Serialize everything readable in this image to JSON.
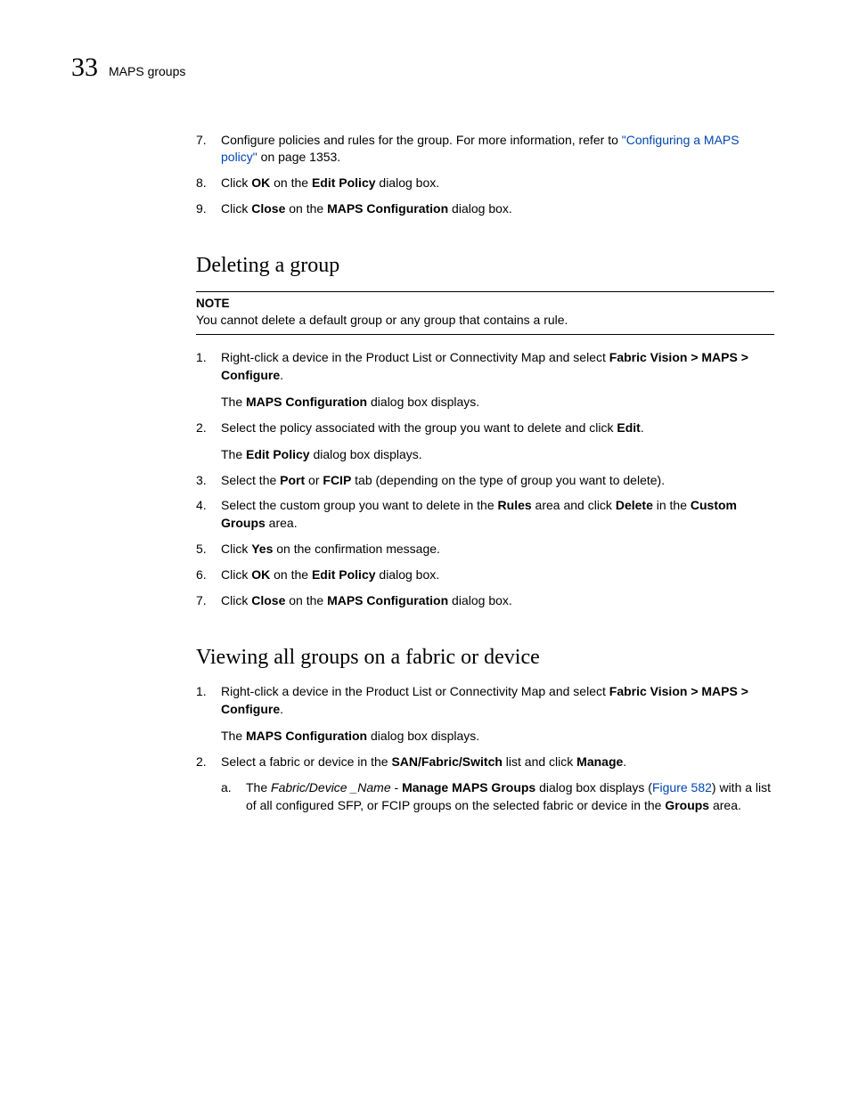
{
  "header": {
    "chapter": "33",
    "title": "MAPS groups"
  },
  "top_list": {
    "item7": {
      "num": "7.",
      "pre": "Configure policies and rules for the group. For more information, refer to ",
      "link": "\"Configuring a MAPS policy\"",
      "post": " on page 1353."
    },
    "item8": {
      "num": "8.",
      "pre": "Click ",
      "b1": "OK",
      "mid1": " on the ",
      "b2": "Edit Policy",
      "post": " dialog box."
    },
    "item9": {
      "num": "9.",
      "pre": "Click ",
      "b1": "Close",
      "mid1": " on the ",
      "b2": "MAPS Configuration",
      "post": " dialog box."
    }
  },
  "section1": {
    "heading": "Deleting a group",
    "note_label": "NOTE",
    "note_text": "You cannot delete a default group or any group that contains a rule.",
    "items": {
      "i1": {
        "num": "1.",
        "pre": "Right-click a device in the Product List or Connectivity Map and select ",
        "b1": "Fabric Vision > MAPS > Configure",
        "post": ".",
        "sub_pre": "The ",
        "sub_b": "MAPS Configuration",
        "sub_post": " dialog box displays."
      },
      "i2": {
        "num": "2.",
        "pre": "Select the policy associated with the group you want to delete and click ",
        "b1": "Edit",
        "post": ".",
        "sub_pre": "The ",
        "sub_b": "Edit Policy",
        "sub_post": " dialog box displays."
      },
      "i3": {
        "num": "3.",
        "pre": "Select the ",
        "b1": "Port",
        "mid1": " or ",
        "b2": "FCIP",
        "post": " tab (depending on the type of group you want to delete)."
      },
      "i4": {
        "num": "4.",
        "pre": "Select the custom group you want to delete in the ",
        "b1": "Rules",
        "mid1": " area and click ",
        "b2": "Delete",
        "mid2": " in the ",
        "b3": "Custom Groups",
        "post": " area."
      },
      "i5": {
        "num": "5.",
        "pre": "Click ",
        "b1": "Yes",
        "post": " on the confirmation message."
      },
      "i6": {
        "num": "6.",
        "pre": "Click ",
        "b1": "OK",
        "mid1": " on the ",
        "b2": "Edit Policy",
        "post": " dialog box."
      },
      "i7": {
        "num": "7.",
        "pre": "Click ",
        "b1": "Close",
        "mid1": " on the ",
        "b2": "MAPS Configuration",
        "post": " dialog box."
      }
    }
  },
  "section2": {
    "heading": "Viewing all groups on a fabric or device",
    "items": {
      "i1": {
        "num": "1.",
        "pre": "Right-click a device in the Product List or Connectivity Map and select ",
        "b1": "Fabric Vision > MAPS > Configure",
        "post": ".",
        "sub_pre": "The ",
        "sub_b": "MAPS Configuration",
        "sub_post": " dialog box displays."
      },
      "i2": {
        "num": "2.",
        "pre": "Select a fabric or device in the ",
        "b1": "SAN/Fabric/Switch",
        "mid1": " list and click ",
        "b2": "Manage",
        "post": ".",
        "letter_a": {
          "letter": "a.",
          "pre": "The ",
          "it1": "Fabric/Device _Name",
          "mid1": " - ",
          "b1": "Manage MAPS Groups",
          "mid2": " dialog box displays (",
          "link": "Figure 582",
          "mid3": ") with a list of all configured SFP, or FCIP groups on the selected fabric or device in the ",
          "b2": "Groups",
          "post": " area."
        }
      }
    }
  }
}
